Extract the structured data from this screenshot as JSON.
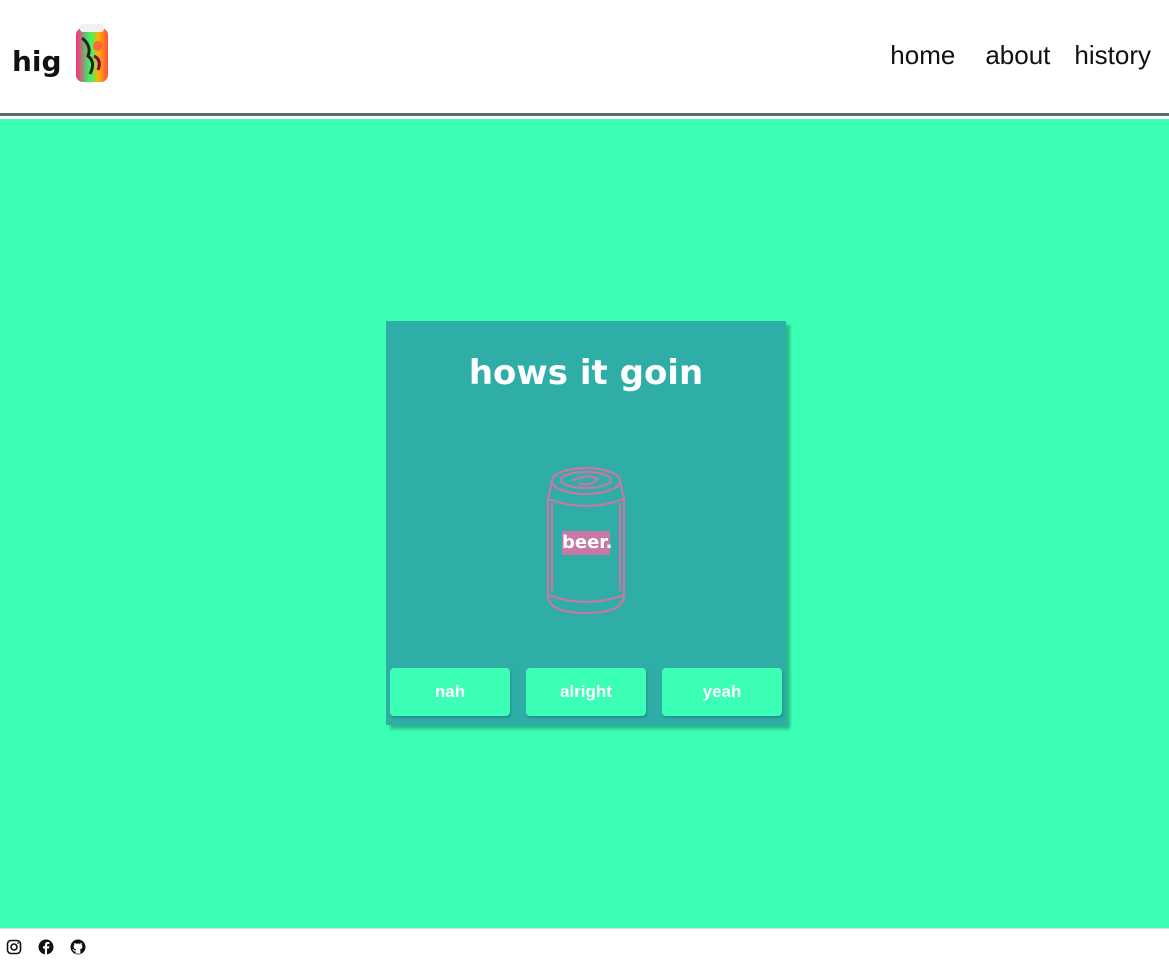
{
  "header": {
    "brand": "hig",
    "nav": [
      "home",
      "about",
      "history"
    ]
  },
  "card": {
    "title": "hows it goin",
    "can_label": "beer.",
    "buttons": [
      "nah",
      "alright",
      "yeah"
    ]
  },
  "footer": {
    "icons": [
      "instagram-icon",
      "facebook-icon",
      "github-icon"
    ]
  },
  "colors": {
    "page_background": "#3cffb6",
    "card_background": "#2eaea7",
    "button_background": "#3cffb6",
    "can_outline": "#c778a4",
    "header_border": "#5f6b6b"
  }
}
